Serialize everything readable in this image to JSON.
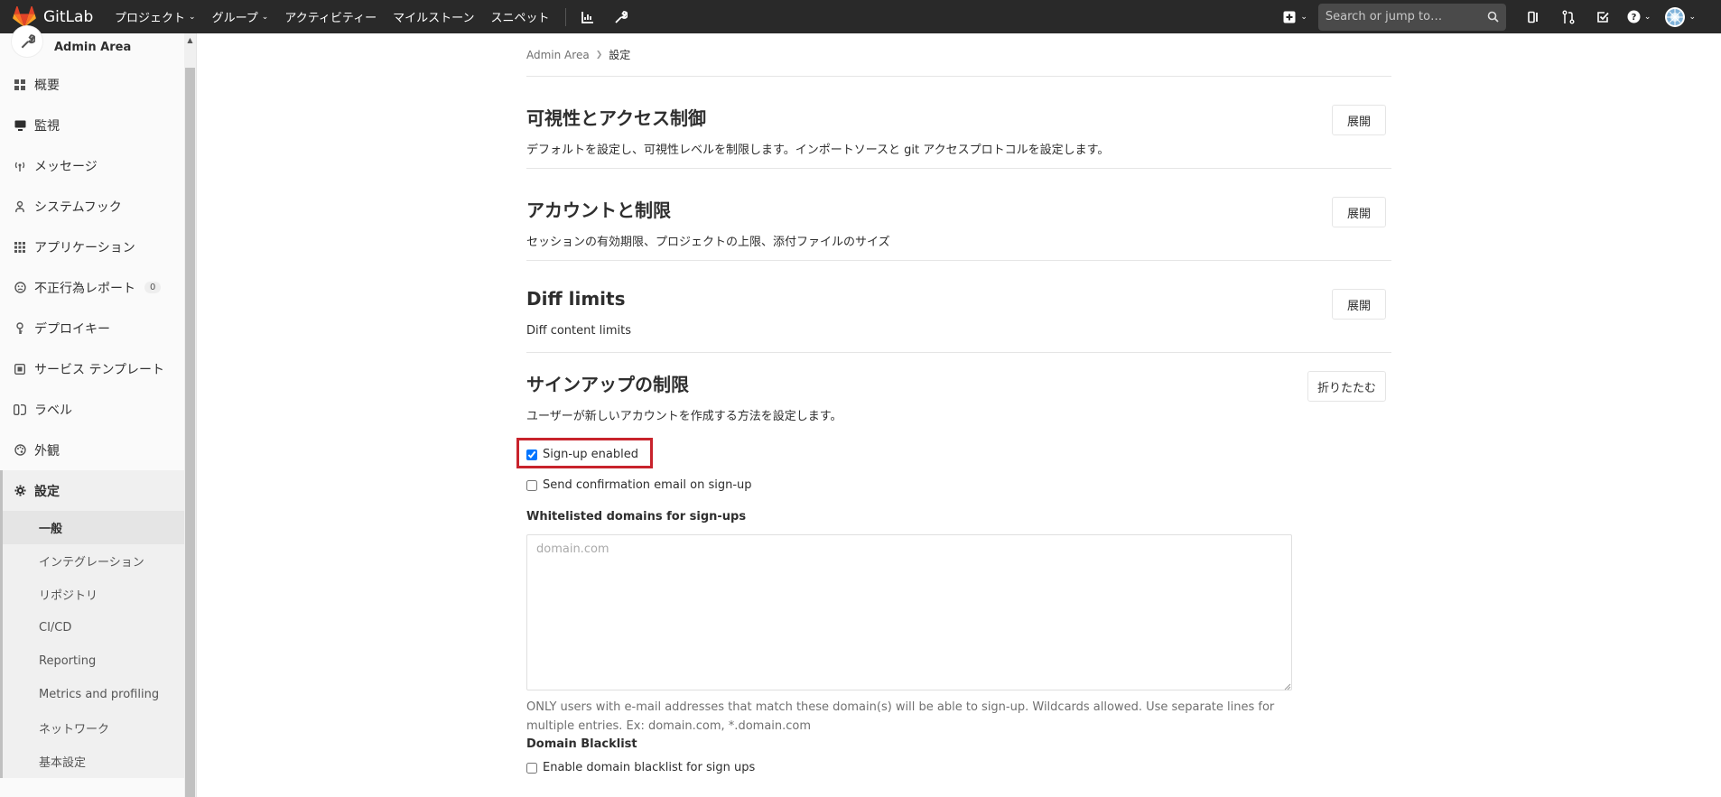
{
  "navbar": {
    "brand": "GitLab",
    "menu": [
      {
        "label": "プロジェクト",
        "dropdown": true
      },
      {
        "label": "グループ",
        "dropdown": true
      },
      {
        "label": "アクティビティー",
        "dropdown": false
      },
      {
        "label": "マイルストーン",
        "dropdown": false
      },
      {
        "label": "スニペット",
        "dropdown": false
      }
    ],
    "search_placeholder": "Search or jump to…",
    "icons": [
      "chart-icon",
      "wrench-icon",
      "plus-icon",
      "search-icon",
      "issues-icon",
      "merge-request-icon",
      "todo-icon",
      "help-icon",
      "avatar-icon"
    ]
  },
  "sidebar": {
    "title": "Admin Area",
    "items": [
      {
        "label": "概要",
        "icon": "overview-icon"
      },
      {
        "label": "監視",
        "icon": "monitor-icon"
      },
      {
        "label": "メッセージ",
        "icon": "broadcast-icon"
      },
      {
        "label": "システムフック",
        "icon": "hook-icon"
      },
      {
        "label": "アプリケーション",
        "icon": "applications-icon"
      },
      {
        "label": "不正行為レポート",
        "icon": "abuse-icon",
        "count": "0"
      },
      {
        "label": "デプロイキー",
        "icon": "key-icon"
      },
      {
        "label": "サービス テンプレート",
        "icon": "template-icon"
      },
      {
        "label": "ラベル",
        "icon": "labels-icon"
      },
      {
        "label": "外観",
        "icon": "appearance-icon"
      },
      {
        "label": "設定",
        "icon": "settings-icon",
        "active": true
      }
    ],
    "sub_items": [
      {
        "label": "一般",
        "active": true
      },
      {
        "label": "インテグレーション"
      },
      {
        "label": "リポジトリ"
      },
      {
        "label": "CI/CD"
      },
      {
        "label": "Reporting"
      },
      {
        "label": "Metrics and profiling"
      },
      {
        "label": "ネットワーク"
      },
      {
        "label": "基本設定"
      }
    ]
  },
  "breadcrumb": {
    "parent": "Admin Area",
    "current": "設定"
  },
  "sections": [
    {
      "title": "可視性とアクセス制御",
      "description": "デフォルトを設定し、可視性レベルを制限します。インポートソースと git アクセスプロトコルを設定します。",
      "button": "展開"
    },
    {
      "title": "アカウントと制限",
      "description": "セッションの有効期限、プロジェクトの上限、添付ファイルのサイズ",
      "button": "展開"
    },
    {
      "title": "Diff limits",
      "description": "Diff content limits",
      "button": "展開"
    }
  ],
  "signup": {
    "title": "サインアップの制限",
    "description": "ユーザーが新しいアカウントを作成する方法を設定します。",
    "button": "折りたたむ",
    "signup_enabled": {
      "label": "Sign-up enabled",
      "checked": true
    },
    "send_confirmation": {
      "label": "Send confirmation email on sign-up",
      "checked": false
    },
    "whitelist_label": "Whitelisted domains for sign-ups",
    "whitelist_placeholder": "domain.com",
    "whitelist_help": "ONLY users with e-mail addresses that match these domain(s) will be able to sign-up. Wildcards allowed. Use separate lines for multiple entries. Ex: domain.com, *.domain.com",
    "blacklist_label": "Domain Blacklist",
    "blacklist_enable": {
      "label": "Enable domain blacklist for sign ups",
      "checked": false
    }
  },
  "colors": {
    "navbar_bg": "#292929",
    "highlight": "#c8232c",
    "gitlab_orange": "#e24329"
  }
}
